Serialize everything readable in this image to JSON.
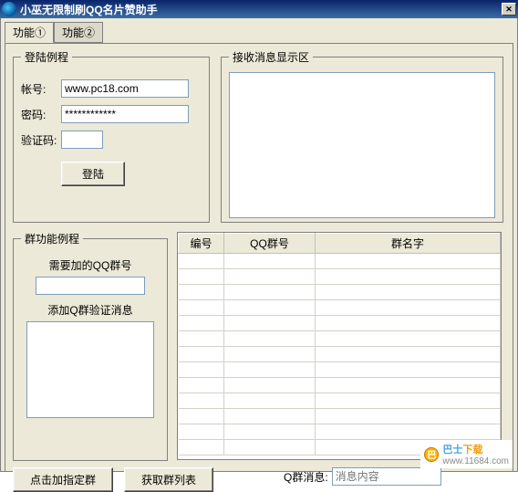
{
  "window": {
    "title": "小巫无限制刷QQ名片赞助手"
  },
  "tabs": {
    "t1": "功能①",
    "t2": "功能②"
  },
  "login": {
    "legend": "登陆例程",
    "account_label": "帐号:",
    "account_value": "www.pc18.com",
    "password_label": "密码:",
    "password_value": "************",
    "captcha_label": "验证码:",
    "captcha_value": "",
    "login_btn": "登陆"
  },
  "msgbox": {
    "legend": "接收消息显示区"
  },
  "group": {
    "legend": "群功能例程",
    "need_add_label": "需要加的QQ群号",
    "qqgroup_value": "",
    "verify_label": "添加Q群验证消息",
    "verify_value": ""
  },
  "grid": {
    "cols": {
      "a": "编号",
      "b": "QQ群号",
      "c": "群名字"
    },
    "rows": [
      {
        "a": "",
        "b": "",
        "c": ""
      },
      {
        "a": "",
        "b": "",
        "c": ""
      },
      {
        "a": "",
        "b": "",
        "c": ""
      },
      {
        "a": "",
        "b": "",
        "c": ""
      },
      {
        "a": "",
        "b": "",
        "c": ""
      },
      {
        "a": "",
        "b": "",
        "c": ""
      },
      {
        "a": "",
        "b": "",
        "c": ""
      },
      {
        "a": "",
        "b": "",
        "c": ""
      },
      {
        "a": "",
        "b": "",
        "c": ""
      },
      {
        "a": "",
        "b": "",
        "c": ""
      },
      {
        "a": "",
        "b": "",
        "c": ""
      },
      {
        "a": "",
        "b": "",
        "c": ""
      },
      {
        "a": "",
        "b": "",
        "c": ""
      }
    ]
  },
  "buttons": {
    "add_group": "点击加指定群",
    "get_list": "获取群列表"
  },
  "qmsg": {
    "label": "Q群消息:",
    "placeholder": "消息内容"
  },
  "watermark": {
    "brand1": "巴士",
    "brand2": "下载",
    "url": "www.11684.com"
  }
}
